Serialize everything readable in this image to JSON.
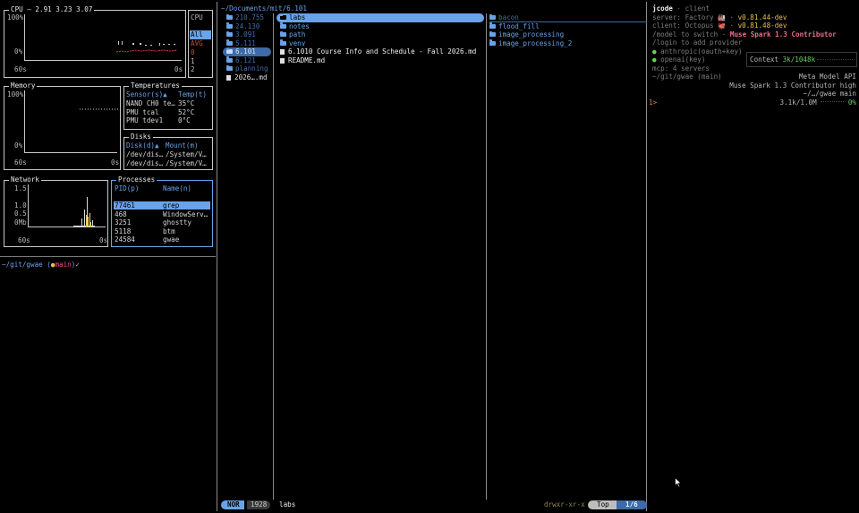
{
  "btm": {
    "cpu": {
      "title": "CPU — 2.91 3.23 3.07",
      "y_top": "100%",
      "y_bot": "0%",
      "x_left": "60s",
      "x_right": "0s",
      "legend_title": "CPU",
      "legend": [
        "All",
        "AVG",
        "0",
        "1",
        "2"
      ],
      "legend_colors": [
        "#6aa3e8",
        "#d04a38",
        "#d04a38",
        "#d8d8d8",
        "#d8d8d8"
      ]
    },
    "memory": {
      "title": "Memory",
      "y_top": "100%",
      "y_bot": "0%",
      "x_left": "60s",
      "x_right": "0s"
    },
    "temperatures": {
      "title": "Temperatures",
      "col1": "Sensor(s)▲",
      "col2": "Temp(t)",
      "rows": [
        {
          "sensor": "NAND CH0 te…",
          "temp": "35°C"
        },
        {
          "sensor": "PMU tcal",
          "temp": "52°C"
        },
        {
          "sensor": "PMU tdev1",
          "temp": "0°C"
        }
      ]
    },
    "disks": {
      "title": "Disks",
      "col1": "Disk(d)▲",
      "col2": "Mount(m)",
      "rows": [
        {
          "disk": "/dev/dis…",
          "mount": "/System/V…"
        },
        {
          "disk": "/dev/dis…",
          "mount": "/System/V…"
        }
      ]
    },
    "network": {
      "title": "Network",
      "y_ticks": [
        "1.5",
        "1.0",
        "0.5",
        "0Mb"
      ],
      "x_left": "60s",
      "x_right": "0s"
    },
    "processes": {
      "title": "Processes",
      "col1": "PID(p)",
      "col2": "Name(n)",
      "rows": [
        {
          "pid": "77461",
          "name": "grep"
        },
        {
          "pid": "468",
          "name": "WindowServ…"
        },
        {
          "pid": "3251",
          "name": "ghostty"
        },
        {
          "pid": "5118",
          "name": "btm"
        },
        {
          "pid": "24584",
          "name": "gwae"
        }
      ]
    }
  },
  "shell": {
    "cwd": "~/git/gwae",
    "branch_open": " (",
    "branch_dot": "●",
    "branch": "main",
    "branch_close": ")",
    "prompt": "✓"
  },
  "files": {
    "path": "~/Documents/mit/6.101",
    "parent": [
      {
        "name": "210.755"
      },
      {
        "name": "24.130"
      },
      {
        "name": "3.091"
      },
      {
        "name": "5.111"
      },
      {
        "name": "6.101",
        "selected": true
      },
      {
        "name": "6.121"
      },
      {
        "name": "planning"
      },
      {
        "name": "2026….md",
        "file": true
      }
    ],
    "current": [
      {
        "name": "labs",
        "selected": true
      },
      {
        "name": "notes"
      },
      {
        "name": "path"
      },
      {
        "name": "venv"
      },
      {
        "name": "6.1010 Course Info and Schedule - Fall 2026.md",
        "file": true
      },
      {
        "name": "README.md",
        "file": true
      }
    ],
    "preview": [
      {
        "name": "bacon"
      },
      {
        "name": "flood_fill"
      },
      {
        "name": "image_processing"
      },
      {
        "name": "image_processing_2"
      }
    ],
    "status": {
      "mode": "NOR",
      "count": "1928",
      "name": "labs",
      "perms": "drwxr-xr-x",
      "pos": "Top",
      "index": "1/6"
    }
  },
  "jcode": {
    "app": "jcode",
    "sep": " · ",
    "role": "client",
    "server_label": "server: Factory ",
    "server_icon": "🏭",
    "server_version": "v0.81.44-dev",
    "client_label": "client: Octopus ",
    "client_icon": "🐙",
    "client_version": "v0.81.48-dev",
    "model_hint": "/model to switch · ",
    "model_name": "Muse Spark 1.3 Contributor",
    "login_hint": "/login to add provider",
    "providers": [
      {
        "name": "anthropic(oauth+key)"
      },
      {
        "name": "openai(key)"
      }
    ],
    "mcp": "mcp: 4 servers",
    "location": "~/git/gwae (main)",
    "context_label": "Context ",
    "context_value": "3k/1048k",
    "api": "Meta Model API",
    "model_line": "Muse Spark 1.3 Contributor high",
    "dir_line": "~/…/gwae  main",
    "usage": "3.1k/1.0M",
    "usage_pct": "0%",
    "prompt": "1>"
  }
}
